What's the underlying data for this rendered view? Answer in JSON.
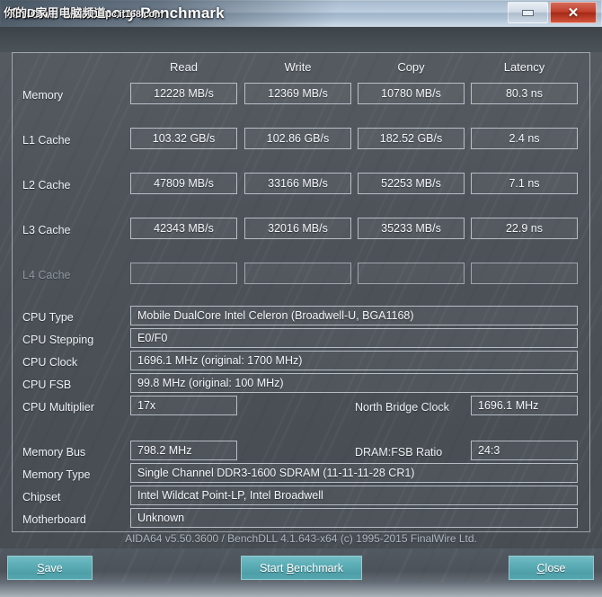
{
  "window": {
    "title": "Cache & Memory Benchmark",
    "watermark_cn": "你的D家用电脑频道",
    "watermark_url": "pc.it168.com",
    "minimize_label": "Minimize",
    "close_label": "Close"
  },
  "benchmark": {
    "columns": [
      "Read",
      "Write",
      "Copy",
      "Latency"
    ],
    "rows": [
      {
        "label": "Memory",
        "disabled": false,
        "values": [
          "12228 MB/s",
          "12369 MB/s",
          "10780 MB/s",
          "80.3 ns"
        ]
      },
      {
        "label": "L1 Cache",
        "disabled": false,
        "values": [
          "103.32 GB/s",
          "102.86 GB/s",
          "182.52 GB/s",
          "2.4 ns"
        ]
      },
      {
        "label": "L2 Cache",
        "disabled": false,
        "values": [
          "47809 MB/s",
          "33166 MB/s",
          "52253 MB/s",
          "7.1 ns"
        ]
      },
      {
        "label": "L3 Cache",
        "disabled": false,
        "values": [
          "42343 MB/s",
          "32016 MB/s",
          "35233 MB/s",
          "22.9 ns"
        ]
      },
      {
        "label": "L4 Cache",
        "disabled": true,
        "values": [
          "",
          "",
          "",
          ""
        ]
      }
    ]
  },
  "cpu_info": {
    "type_label": "CPU Type",
    "type_value": "Mobile DualCore Intel Celeron  (Broadwell-U, BGA1168)",
    "stepping_label": "CPU Stepping",
    "stepping_value": "E0/F0",
    "clock_label": "CPU Clock",
    "clock_value": "1696.1 MHz  (original: 1700 MHz)",
    "fsb_label": "CPU FSB",
    "fsb_value": "99.8 MHz  (original: 100 MHz)",
    "multiplier_label": "CPU Multiplier",
    "multiplier_value": "17x",
    "north_bridge_label": "North Bridge Clock",
    "north_bridge_value": "1696.1 MHz"
  },
  "memory_info": {
    "bus_label": "Memory Bus",
    "bus_value": "798.2 MHz",
    "ratio_label": "DRAM:FSB Ratio",
    "ratio_value": "24:3",
    "type_label": "Memory Type",
    "type_value": "Single Channel DDR3-1600 SDRAM  (11-11-11-28 CR1)",
    "chipset_label": "Chipset",
    "chipset_value": "Intel Wildcat Point-LP, Intel Broadwell",
    "motherboard_label": "Motherboard",
    "motherboard_value": "Unknown"
  },
  "footer": {
    "credit": "AIDA64 v5.50.3600 / BenchDLL 4.1.643-x64  (c) 1995-2015 FinalWire Ltd."
  },
  "buttons": {
    "save": "Save",
    "save_pre": "S",
    "save_post": "ave",
    "start_pre": "Start ",
    "start_accel": "B",
    "start_post": "enchmark",
    "start_full": "Start Benchmark",
    "close_pre": "C",
    "close_post": "lose",
    "close_full": "Close"
  },
  "colors": {
    "accent_button": "#5fb0b9",
    "close_red": "#c2402c",
    "panel_bg": "#4b5157",
    "text": "#eef2f6",
    "text_dim": "#8e969e"
  }
}
